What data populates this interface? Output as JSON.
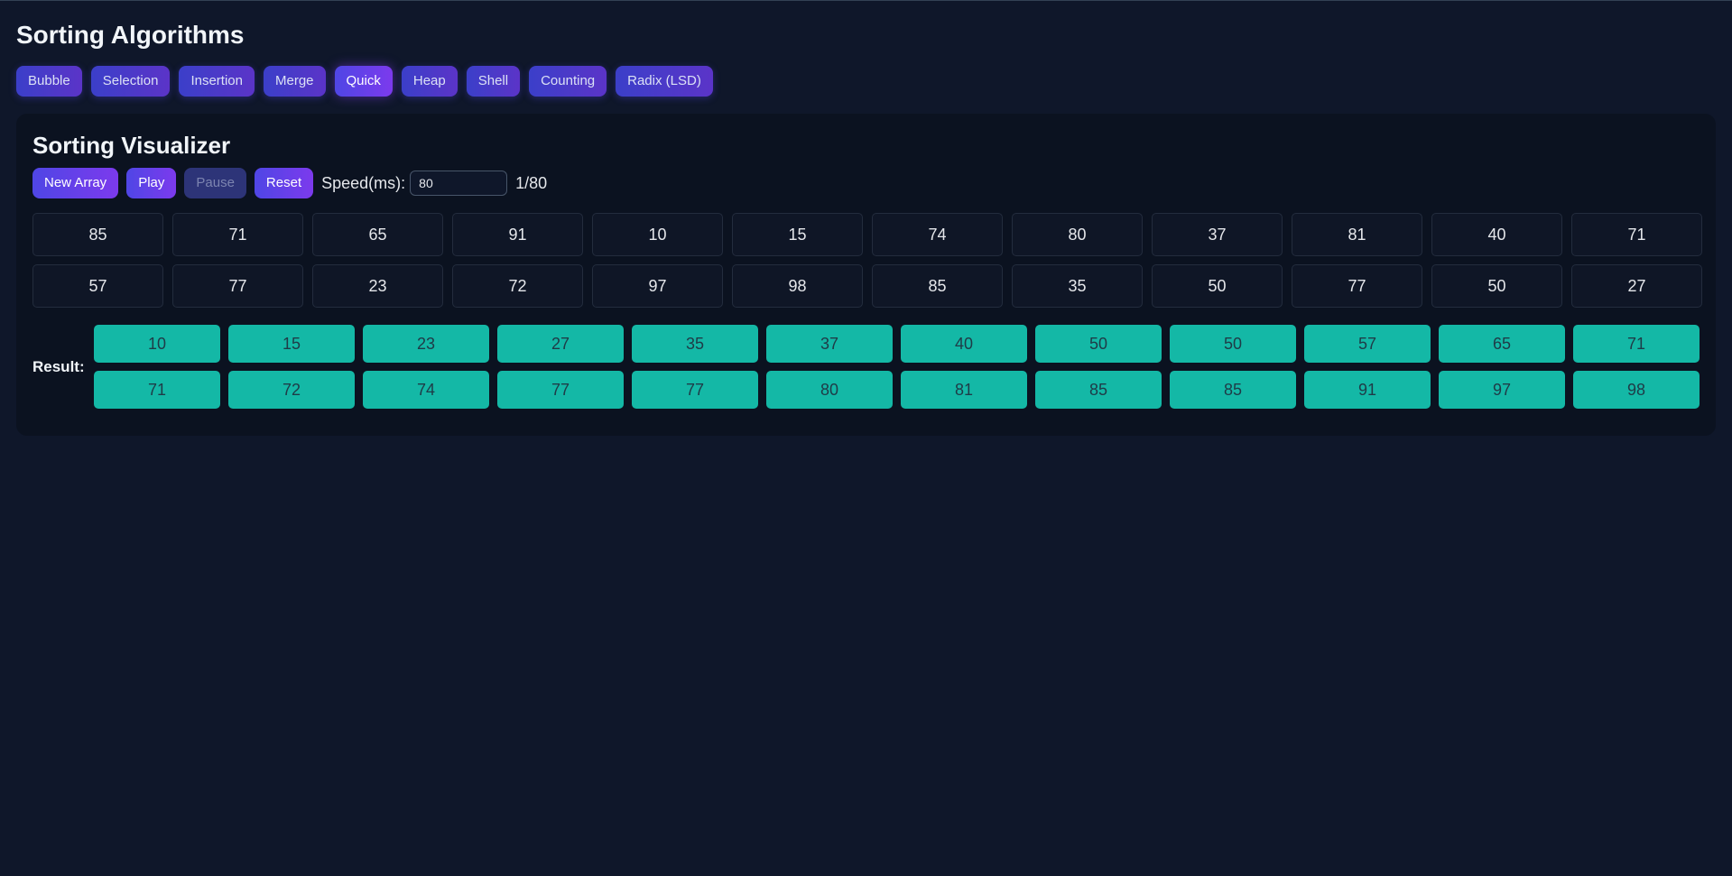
{
  "page": {
    "title": "Sorting Algorithms"
  },
  "algorithms": [
    {
      "label": "Bubble",
      "active": false
    },
    {
      "label": "Selection",
      "active": false
    },
    {
      "label": "Insertion",
      "active": false
    },
    {
      "label": "Merge",
      "active": false
    },
    {
      "label": "Quick",
      "active": true
    },
    {
      "label": "Heap",
      "active": false
    },
    {
      "label": "Shell",
      "active": false
    },
    {
      "label": "Counting",
      "active": false
    },
    {
      "label": "Radix (LSD)",
      "active": false
    }
  ],
  "visualizer": {
    "title": "Sorting Visualizer",
    "controls": {
      "new_array_label": "New Array",
      "play_label": "Play",
      "pause_label": "Pause",
      "reset_label": "Reset",
      "speed_label": "Speed(ms):",
      "speed_value": "80",
      "step_counter": "1/80"
    },
    "array": [
      85,
      71,
      65,
      91,
      10,
      15,
      74,
      80,
      37,
      81,
      40,
      71,
      57,
      77,
      23,
      72,
      97,
      98,
      85,
      35,
      50,
      77,
      50,
      27
    ],
    "result_label": "Result:",
    "result": [
      10,
      15,
      23,
      27,
      35,
      37,
      40,
      50,
      50,
      57,
      65,
      71,
      71,
      72,
      74,
      77,
      77,
      80,
      81,
      85,
      85,
      91,
      97,
      98
    ]
  },
  "colors": {
    "background": "#0f172a",
    "panel": "#0b1220",
    "accent_start": "#4f46e5",
    "accent_end": "#7c3aed",
    "result_cell": "#14b8a6"
  }
}
